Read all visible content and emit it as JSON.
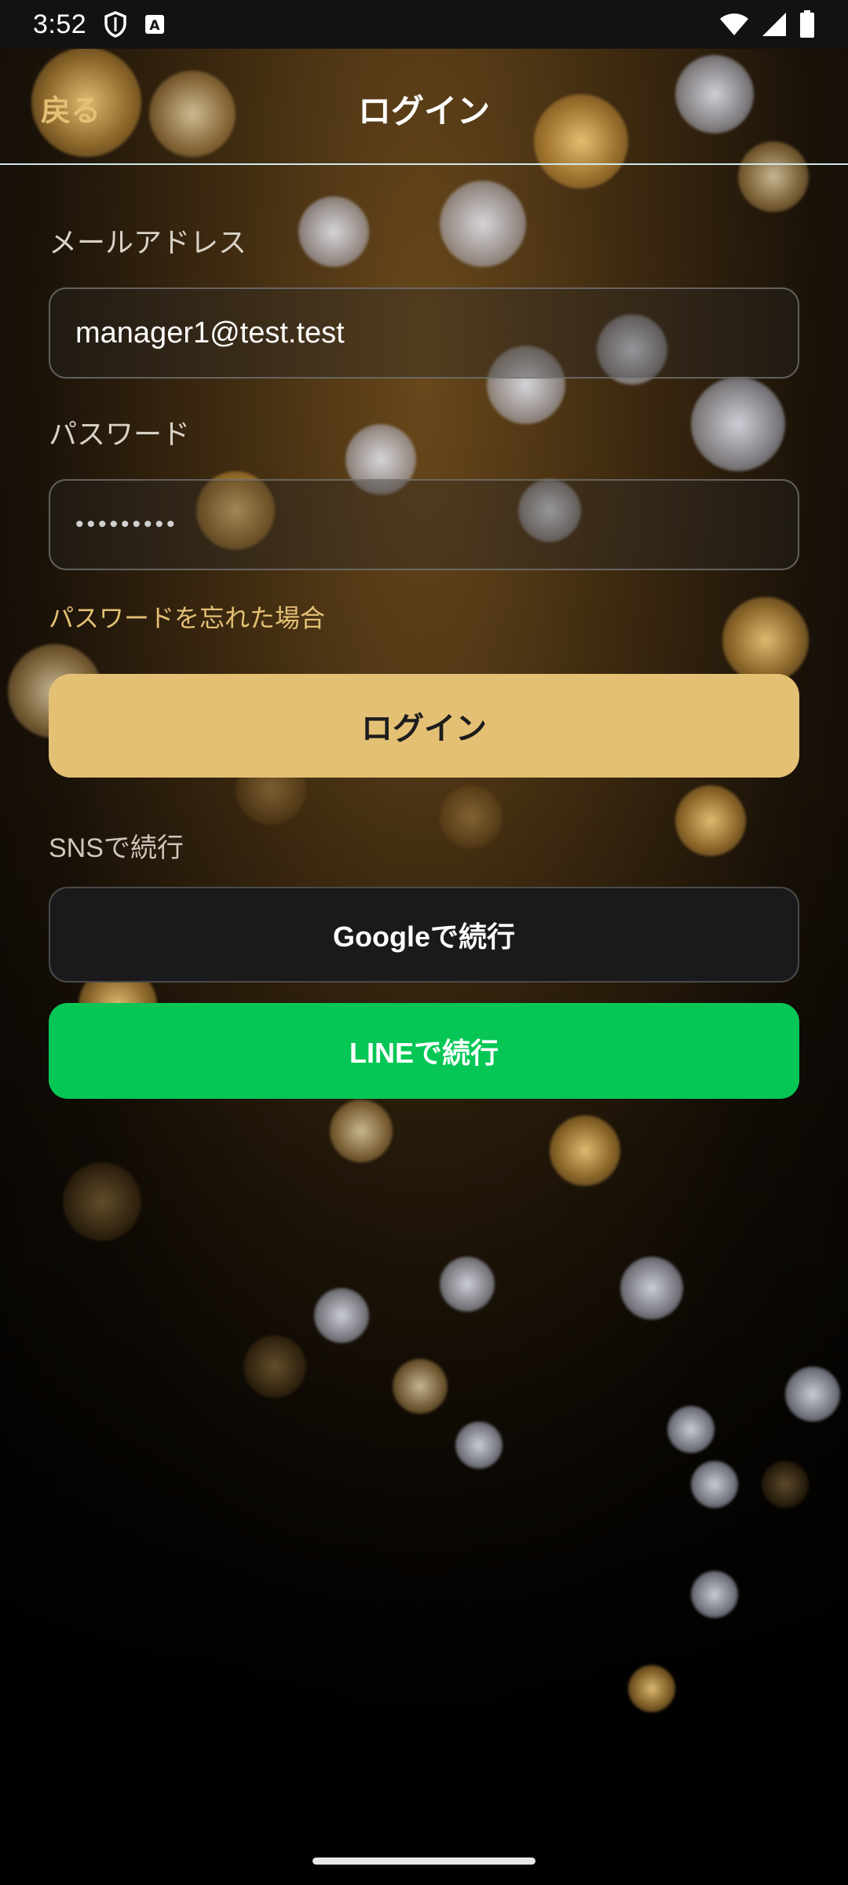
{
  "status_bar": {
    "time": "3:52",
    "icons": [
      "shield-icon",
      "keyboard-a-icon",
      "wifi-icon",
      "signal-icon",
      "battery-icon"
    ]
  },
  "header": {
    "back_label": "戻る",
    "title": "ログイン"
  },
  "form": {
    "email_label": "メールアドレス",
    "email_value": "manager1@test.test",
    "password_label": "パスワード",
    "password_value": "•••••••••",
    "forgot_password": "パスワードを忘れた場合",
    "login_button": "ログイン",
    "sns_label": "SNSで続行",
    "google_button": "Googleで続行",
    "line_button": "LINEで続行"
  },
  "colors": {
    "accent": "#e3c074",
    "line_green": "#06c755",
    "google_bg": "#1a1a1c",
    "header_rule": "#cfe8ea"
  }
}
